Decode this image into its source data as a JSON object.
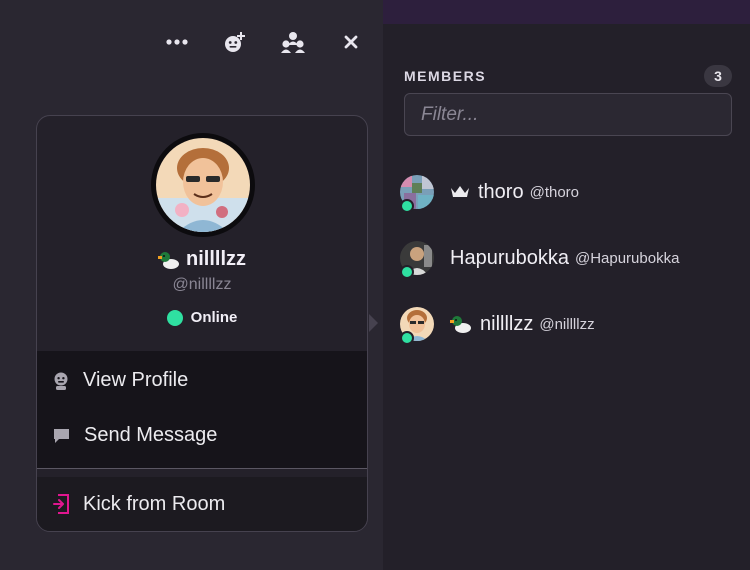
{
  "toolbar": {
    "more_icon": "more-dots-icon",
    "add_emoji_icon": "add-reaction-icon",
    "members_icon": "members-icon",
    "close_icon": "close-icon"
  },
  "popover": {
    "name": "nillllzz",
    "handle": "@nillllzz",
    "status": "Online",
    "badge_icon": "duck-icon",
    "menu": [
      {
        "label": "View Profile",
        "icon": "profile-icon"
      },
      {
        "label": "Send Message",
        "icon": "message-icon"
      }
    ],
    "kick_label": "Kick from Room",
    "kick_icon": "exit-icon"
  },
  "members": {
    "title": "MEMBERS",
    "count": "3",
    "filter_placeholder": "Filter...",
    "list": [
      {
        "name": "thoro",
        "handle": "@thoro",
        "badge": "crown-icon",
        "status": "online"
      },
      {
        "name": "Hapurubokka",
        "handle": "@Hapurubokka",
        "badge": "",
        "status": "online"
      },
      {
        "name": "nillllzz",
        "handle": "@nillllzz",
        "badge": "duck-icon",
        "status": "online"
      }
    ]
  },
  "colors": {
    "online": "#2fe0a1",
    "kick_accent": "#e0168f",
    "top_strip": "#2d1f3d"
  }
}
